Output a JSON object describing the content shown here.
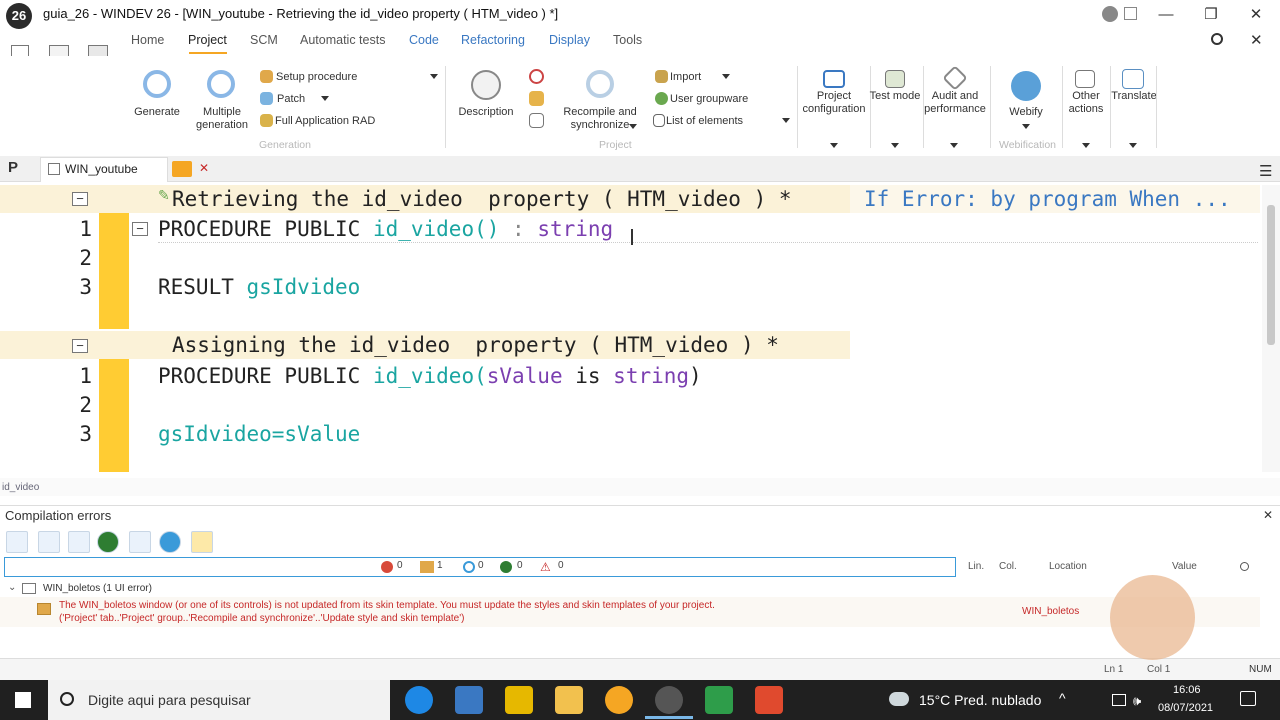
{
  "window": {
    "logo": "26",
    "title": "guia_26 - WINDEV 26 - [WIN_youtube - Retrieving the id_video property ( HTM_video ) *]",
    "minimize": "—",
    "maximize": "❐",
    "close": "✕"
  },
  "ribbon": {
    "tabs": [
      "Home",
      "Project",
      "SCM",
      "Automatic tests",
      "Code",
      "Refactoring",
      "Display",
      "Tools"
    ],
    "active_tab": "Project",
    "generation": {
      "generate": "Generate",
      "multiple_generation": "Multiple generation",
      "setup_procedure": "Setup procedure",
      "patch": "Patch",
      "full_application_rad": "Full Application RAD",
      "group_label": "Generation"
    },
    "project": {
      "description": "Description",
      "recompile": "Recompile and synchronize",
      "import": "Import",
      "user_groupware": "User groupware",
      "list_of_elements": "List of elements",
      "group_label": "Project"
    },
    "project_configuration": "Project configuration",
    "test_mode": "Test mode",
    "audit_performance": "Audit and performance",
    "webify": "Webify",
    "webification_label": "Webification",
    "other_actions": "Other actions",
    "translate": "Translate"
  },
  "doctabs": {
    "project_icon": "P",
    "window_tab": "WIN_youtube",
    "close": "✕"
  },
  "editor": {
    "block1": {
      "header": "Retrieving the id_video  property ( HTM_video ) *",
      "header_right": "If Error: by program When ...",
      "lines": [
        {
          "num": "1",
          "text": "PROCEDURE PUBLIC id_video() : string"
        },
        {
          "num": "2",
          "text": ""
        },
        {
          "num": "3",
          "text": "RESULT gsIdvideo"
        }
      ]
    },
    "block2": {
      "header": "Assigning the id_video  property ( HTM_video ) *",
      "lines": [
        {
          "num": "1",
          "text": "PROCEDURE PUBLIC id_video(sValue is string)"
        },
        {
          "num": "2",
          "text": ""
        },
        {
          "num": "3",
          "text": "gsIdvideo=sValue"
        }
      ]
    }
  },
  "breadcrumb": "id_video",
  "compilation": {
    "title": "Compilation errors",
    "counts": [
      "0",
      "1",
      "0",
      "0",
      "0"
    ],
    "columns": [
      "Lin.",
      "Col.",
      "Location",
      "Value"
    ],
    "group": "WIN_boletos (1 UI error)",
    "error_line1": "The WIN_boletos window (or one of its controls) is not updated from its skin template. You must update the styles and skin templates of your project.",
    "error_line2": "('Project' tab..'Project' group..'Recompile and synchronize'..'Update style and skin template')",
    "error_location": "WIN_boletos"
  },
  "statusbar": {
    "ln": "Ln 1",
    "col": "Col 1",
    "num": "NUM"
  },
  "taskbar": {
    "search_placeholder": "Digite aqui para pesquisar",
    "weather": "15°C  Pred. nublado",
    "time": "16:06",
    "date": "08/07/2021"
  }
}
